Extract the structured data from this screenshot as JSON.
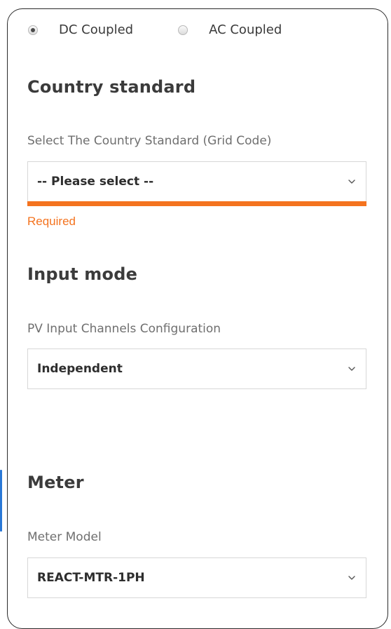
{
  "coupling": {
    "options": [
      {
        "label": "DC Coupled",
        "checked": true
      },
      {
        "label": "AC Coupled",
        "checked": false
      }
    ]
  },
  "country": {
    "title": "Country standard",
    "field_label": "Select The Country Standard (Grid Code)",
    "value": "-- Please select --",
    "error": "Required",
    "error_color": "#f4731f"
  },
  "input_mode": {
    "title": "Input mode",
    "field_label": "PV Input Channels Configuration",
    "value": "Independent"
  },
  "meter": {
    "title": "Meter",
    "field_label": "Meter Model",
    "value": "REACT-MTR-1PH"
  }
}
